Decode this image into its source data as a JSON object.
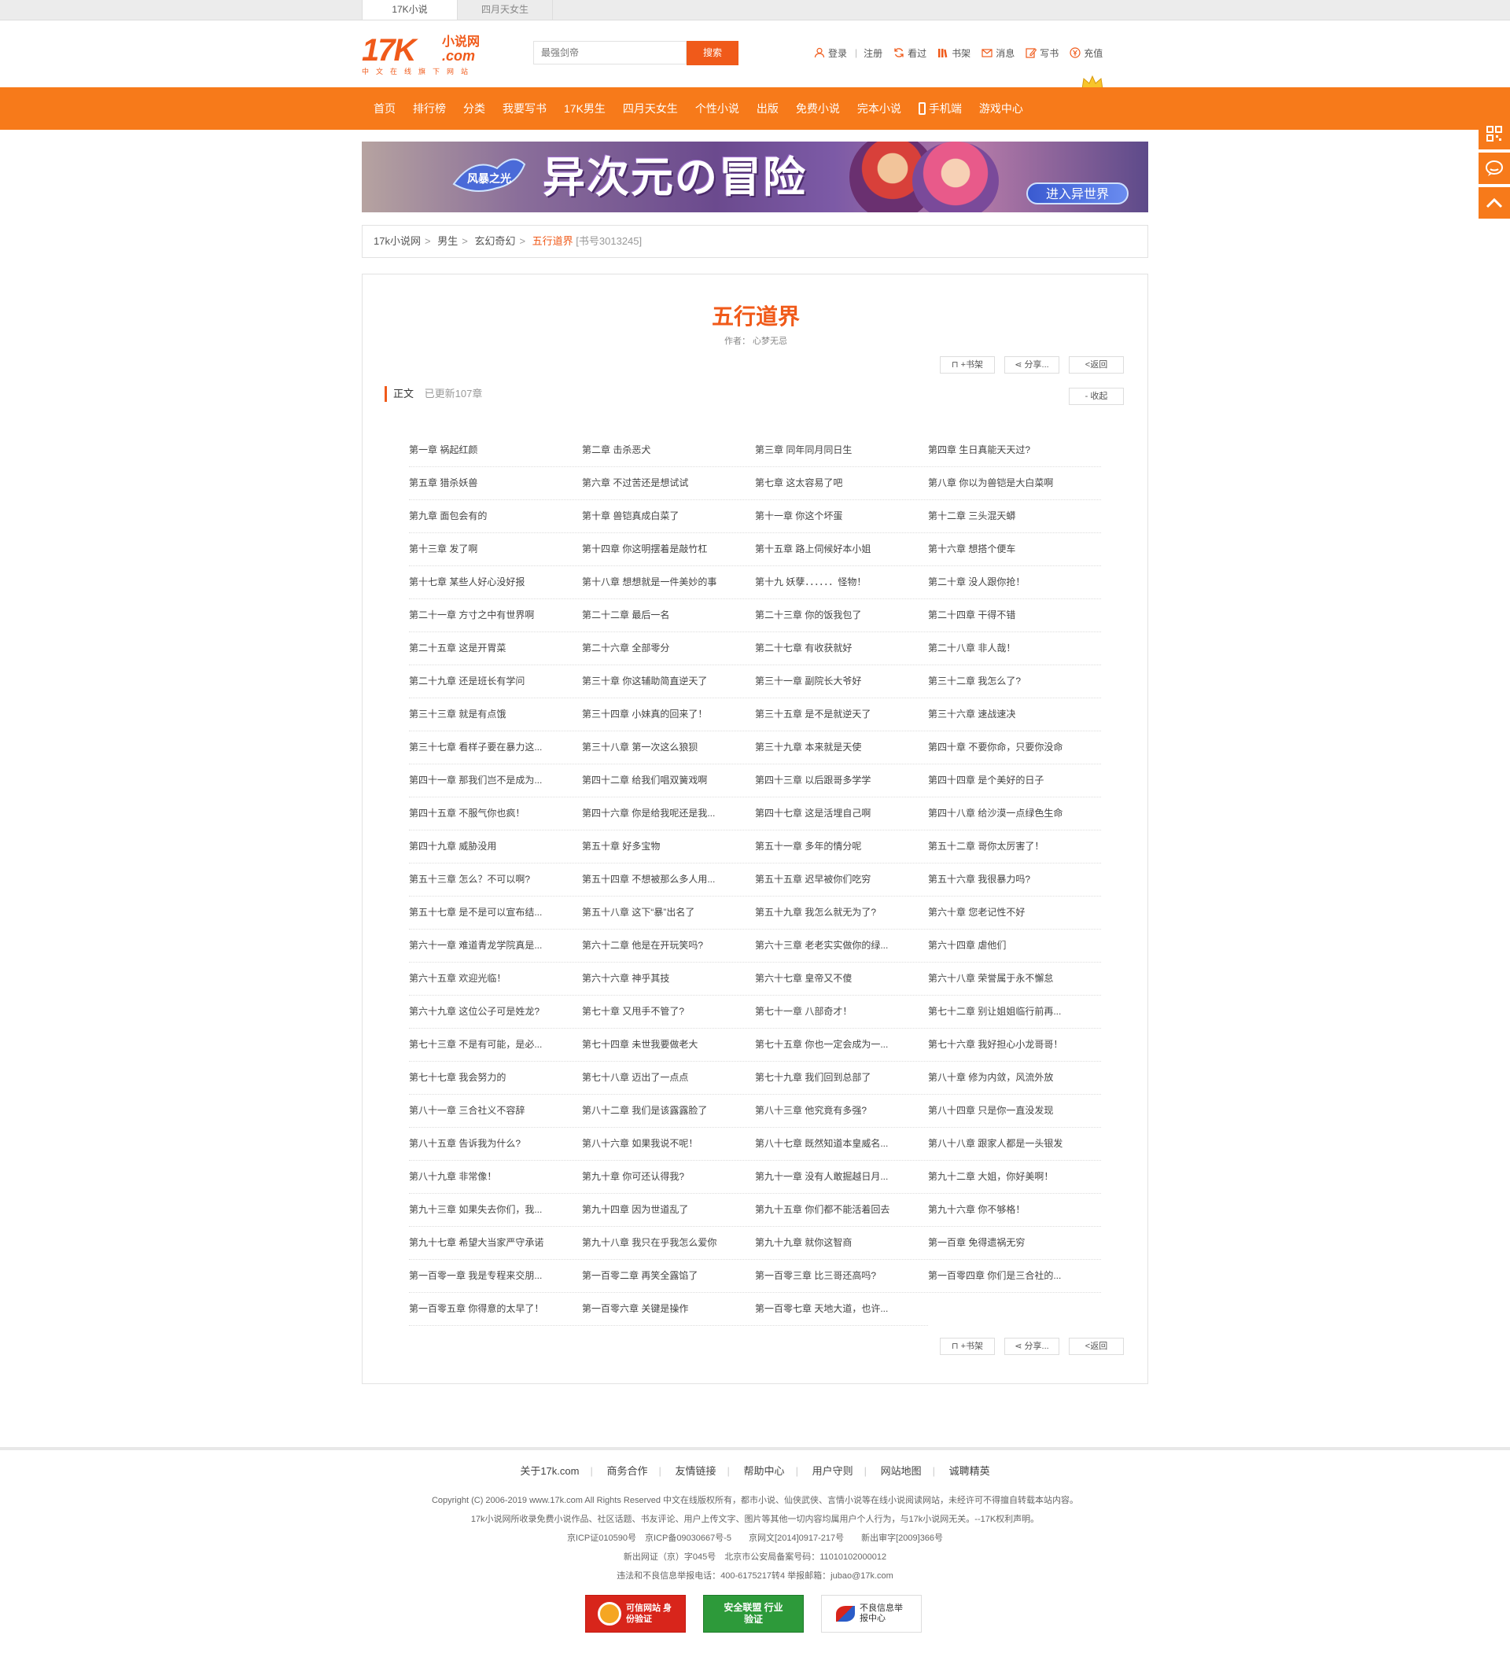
{
  "top_tabs": [
    "17K小说",
    "四月天女生"
  ],
  "header": {
    "logo_main": "17K",
    "logo_cn": "小说网",
    "logo_com": ".com",
    "logo_slogan": "中文在线旗下网站",
    "search_placeholder": "最强剑帝",
    "search_button": "搜索",
    "links": {
      "login": "登录",
      "register": "注册",
      "history": "看过",
      "shelf": "书架",
      "message": "消息",
      "write": "写书",
      "recharge": "充值"
    }
  },
  "nav": [
    "首页",
    "排行榜",
    "分类",
    "我要写书",
    "17K男生",
    "四月天女生",
    "个性小说",
    "出版",
    "免费小说",
    "完本小说",
    "手机端",
    "游戏中心"
  ],
  "banner": {
    "title": "异次元の冒险",
    "game_name": "风暴之光",
    "button": "进入异世界"
  },
  "breadcrumb": {
    "home": "17k小说网",
    "channel": "男生",
    "category": "玄幻奇幻",
    "book": "五行道界",
    "book_no": "[书号3013245]"
  },
  "book": {
    "title": "五行道界",
    "author_label": "作者：",
    "author": "心梦无忌",
    "add_shelf": "+书架",
    "share": "分享...",
    "back": "<返回",
    "collapse": "- 收起",
    "section_label": "正文",
    "updated": "已更新107章"
  },
  "chapters": [
    "第一章 祸起红颜",
    "第二章 击杀恶犬",
    "第三章 同年同月同日生",
    "第四章 生日真能天天过?",
    "第五章 猎杀妖兽",
    "第六章 不过苦还是想试试",
    "第七章 这太容易了吧",
    "第八章 你以为兽铠是大白菜啊",
    "第九章 面包会有的",
    "第十章 兽铠真成白菜了",
    "第十一章 你这个坏蛋",
    "第十二章 三头混天蟒",
    "第十三章 发了啊",
    "第十四章 你这明摆着是敲竹杠",
    "第十五章 路上伺候好本小姐",
    "第十六章 想搭个便车",
    "第十七章 某些人好心没好报",
    "第十八章 想想就是一件美妙的事",
    "第十九 妖孽．．．．．．怪物！",
    "第二十章 没人跟你抢！",
    "第二十一章 方寸之中有世界啊",
    "第二十二章 最后一名",
    "第二十三章 你的饭我包了",
    "第二十四章 干得不错",
    "第二十五章 这是开胃菜",
    "第二十六章 全部零分",
    "第二十七章 有收获就好",
    "第二十八章 非人哉！",
    "第二十九章 还是班长有学问",
    "第三十章 你这辅助简直逆天了",
    "第三十一章 副院长大爷好",
    "第三十二章 我怎么了?",
    "第三十三章 就是有点饿",
    "第三十四章 小妹真的回来了！",
    "第三十五章 是不是就逆天了",
    "第三十六章 速战速决",
    "第三十七章 看样子要在暴力这...",
    "第三十八章 第一次这么狼狈",
    "第三十九章 本来就是天使",
    "第四十章 不要你命，只要你没命",
    "第四十一章 那我们岂不是成为...",
    "第四十二章 给我们唱双簧戏啊",
    "第四十三章 以后跟哥多学学",
    "第四十四章 是个美好的日子",
    "第四十五章 不服气你也疯！",
    "第四十六章 你是给我呢还是我...",
    "第四十七章 这是活埋自己啊",
    "第四十八章 给沙漠一点绿色生命",
    "第四十九章 威胁没用",
    "第五十章 好多宝物",
    "第五十一章 多年的情分呢",
    "第五十二章 哥你太厉害了！",
    "第五十三章 怎么？不可以啊?",
    "第五十四章 不想被那么多人用...",
    "第五十五章 迟早被你们吃穷",
    "第五十六章 我很暴力吗?",
    "第五十七章 是不是可以宣布结...",
    "第五十八章 这下“暴”出名了",
    "第五十九章 我怎么就无为了?",
    "第六十章 您老记性不好",
    "第六十一章 难道青龙学院真是...",
    "第六十二章 他是在开玩笑吗?",
    "第六十三章 老老实实做你的绿...",
    "第六十四章 虐他们",
    "第六十五章 欢迎光临！",
    "第六十六章 神乎其技",
    "第六十七章 皇帝又不傻",
    "第六十八章 荣誉属于永不懈怠",
    "第六十九章 这位公子可是姓龙?",
    "第七十章 又甩手不管了?",
    "第七十一章 八部奇才！",
    "第七十二章 别让姐姐临行前再...",
    "第七十三章 不是有可能，是必...",
    "第七十四章 未世我要做老大",
    "第七十五章 你也一定会成为一...",
    "第七十六章 我好担心小龙哥哥！",
    "第七十七章 我会努力的",
    "第七十八章 迈出了一点点",
    "第七十九章 我们回到总部了",
    "第八十章 修为内敛，风流外放",
    "第八十一章 三合社义不容辞",
    "第八十二章 我们是该露露脸了",
    "第八十三章 他究竟有多强?",
    "第八十四章 只是你一直没发现",
    "第八十五章 告诉我为什么?",
    "第八十六章 如果我说不呢！",
    "第八十七章 既然知道本皇威名...",
    "第八十八章 跟家人都是一头银发",
    "第八十九章 非常像！",
    "第九十章 你可还认得我?",
    "第九十一章 没有人敢掘越日月...",
    "第九十二章 大姐，你好美啊！",
    "第九十三章 如果失去你们，我...",
    "第九十四章 因为世道乱了",
    "第九十五章 你们都不能活着回去",
    "第九十六章 你不够格！",
    "第九十七章 希望大当家严守承诺",
    "第九十八章 我只在乎我怎么爱你",
    "第九十九章 就你这智商",
    "第一百章 免得遗祸无穷",
    "第一百零一章 我是专程来交朋...",
    "第一百零二章 再笑全露馅了",
    "第一百零三章 比三哥还高吗?",
    "第一百零四章 你们是三合社的...",
    "第一百零五章 你得意的太早了！",
    "第一百零六章 关键是操作",
    "第一百零七章 天地大道，也许..."
  ],
  "footer": {
    "links": [
      "关于17k.com",
      "商务合作",
      "友情链接",
      "帮助中心",
      "用户守则",
      "网站地图",
      "诚聘精英"
    ],
    "lines": [
      "Copyright (C) 2006-2019 www.17k.com All Rights Reserved 中文在线版权所有，都市小说、仙侠武侠、言情小说等在线小说阅读网站，未经许可不得擅自转载本站内容。",
      "17k小说网所收录免费小说作品、社区话题、书友评论、用户上传文字、图片等其他一切内容均属用户个人行为，与17k小说网无关。--17K权利声明。",
      "京ICP证010590号　京ICP备09030667号-5　　京网文[2014]0917-217号　　新出审字[2009]366号",
      "新出网证（京）字045号　北京市公安局备案号码：110101020000​12",
      "违法和不良信息举报电话：400-6175217转4 举报邮箱：jubao@17k.com"
    ],
    "badges": [
      "可信网站 身份验证",
      "安全联盟 行业验证",
      "不良信息举报中心"
    ]
  },
  "colors": {
    "brand": "#f05a1a",
    "nav_bg": "#f77a1a"
  }
}
